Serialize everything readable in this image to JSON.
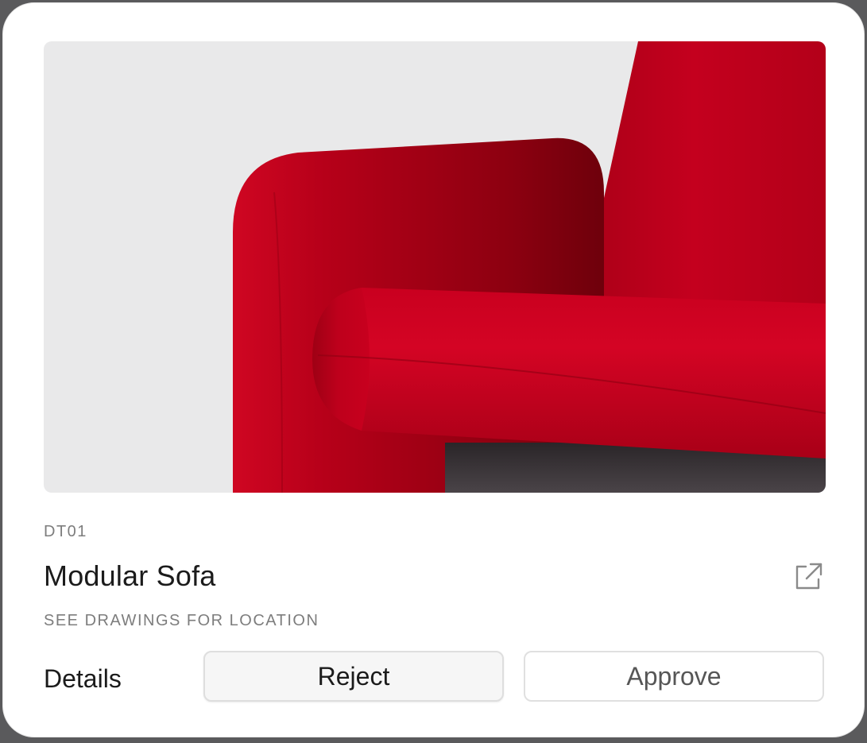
{
  "product": {
    "code": "DT01",
    "name": "Modular Sofa",
    "location": "SEE DRAWINGS FOR LOCATION"
  },
  "actions": {
    "details_label": "Details",
    "reject_label": "Reject",
    "approve_label": "Approve"
  },
  "icons": {
    "external": "external-link-icon"
  },
  "colors": {
    "fabric": "#c8001e",
    "photo_background": "#e9e9ea",
    "text_primary": "#1b1b1b",
    "text_secondary": "#7d7d7d"
  }
}
